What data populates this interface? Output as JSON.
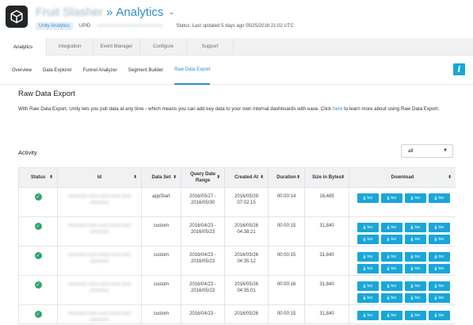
{
  "header": {
    "project_name": "Fruit Slasher",
    "title_sep": "»",
    "title": "Analytics",
    "product_chip": "Unity Analytics",
    "upid_label": "UPID",
    "upid_value": "xxxxxxxxxxxxxxxxxxxxxxxx",
    "status": "Status: Last updated 5 days ago 05/25/2016 21:02 UTC"
  },
  "tabs": [
    "Analytics",
    "Integration",
    "Event Manager",
    "Configure",
    "Support"
  ],
  "subtabs": [
    "Overview",
    "Data Explorer",
    "Funnel Analyzer",
    "Segment Builder",
    "Raw Data Export"
  ],
  "info_button": "i",
  "page": {
    "title": "Raw Data Export",
    "desc_before_link": "With Raw Data Export, Unity lets you pull data at any time - which means you can add key data to your own internal dashboards with ease. Click ",
    "desc_link": "here",
    "desc_after_link": " to learn more about using Raw Data Export."
  },
  "activity": {
    "label": "Activity",
    "filter_value": "all"
  },
  "table": {
    "headers": [
      "Status",
      "Id",
      "Data Set",
      "Query Date Range",
      "Created At",
      "Duration",
      "Size in Bytes",
      "Download"
    ],
    "rows": [
      {
        "id": "xxxxxxxx-xxxx-xxxx-xxxx-xxxxxxxxxxxx",
        "dataset": "appStart",
        "range": "2016/05/27 - 2016/05/30",
        "created": "2016/05/29 07:02:15",
        "duration": "00:00:14",
        "size": "16,485",
        "downloads": [
          "tsv",
          "tsv",
          "tsv",
          "tsv"
        ]
      },
      {
        "id": "xxxxxxxx-xxxx-xxxx-xxxx-xxxxxxxxxxxx",
        "dataset": "custom",
        "range": "2016/04/23 - 2016/05/23",
        "created": "2016/05/26 04:38:21",
        "duration": "00:00:15",
        "size": "31,840",
        "downloads": [
          "tsv",
          "tsv",
          "tsv",
          "tsv",
          "tsv",
          "tsv",
          "tsv",
          "tsv"
        ]
      },
      {
        "id": "xxxxxxxx-xxxx-xxxx-xxxx-xxxxxxxxxxxx",
        "dataset": "custom",
        "range": "2016/04/23 - 2016/05/23",
        "created": "2016/05/26 04:35:12",
        "duration": "00:00:15",
        "size": "31,840",
        "downloads": [
          "tsv",
          "tsv",
          "tsv",
          "tsv",
          "tsv",
          "tsv",
          "tsv",
          "tsv"
        ]
      },
      {
        "id": "xxxxxxxx-xxxx-xxxx-xxxx-xxxxxxxxxxxx",
        "dataset": "custom",
        "range": "2016/04/23 - 2016/05/23",
        "created": "2016/05/26 04:35:01",
        "duration": "00:00:16",
        "size": "31,840",
        "downloads": [
          "tsv",
          "tsv",
          "tsv",
          "tsv",
          "tsv",
          "tsv",
          "tsv",
          "tsv"
        ]
      },
      {
        "id": "xxxxxxxx-xxxx-xxxx-xxxx-xxxxxxxxxxxx",
        "dataset": "custom",
        "range": "2016/04/23 -",
        "created": "2016/05/26",
        "duration": "00:00:15",
        "size": "31,840",
        "downloads": [
          "tsv",
          "tsv",
          "tsv",
          "tsv"
        ]
      }
    ]
  },
  "colors": {
    "accent": "#2f8ec8",
    "button": "#19a6d8",
    "success": "#2ea56b"
  }
}
